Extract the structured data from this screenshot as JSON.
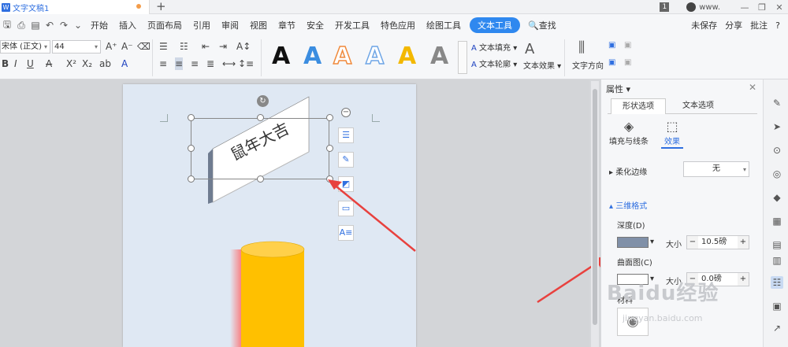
{
  "app": {
    "tab_title": "文字文稿1",
    "logo": "W",
    "page_badge": "1",
    "user": "www.",
    "window": {
      "minimize": "—",
      "restore": "❐",
      "close": "✕"
    }
  },
  "menubar": {
    "items": [
      "开始",
      "插入",
      "页面布局",
      "引用",
      "审阅",
      "视图",
      "章节",
      "安全",
      "开发工具",
      "特色应用",
      "绘图工具",
      "文本工具"
    ],
    "active": "文本工具",
    "search": "查找",
    "right": [
      "未保存",
      "分享",
      "批注"
    ],
    "help": "?"
  },
  "ribbon": {
    "font": "宋体 (正文)",
    "size": "44",
    "art_letter": "A",
    "art_colors": [
      "#111111",
      "#3b8de0",
      "#f08a3c",
      "#6fa6e6",
      "#f3b800",
      "#888888"
    ],
    "text_fill": "文本填充",
    "text_outline": "文本轮廓",
    "text_effect": "文本效果",
    "text_direction": "文字方向"
  },
  "document": {
    "shape_text": "鼠年大吉",
    "cylinder_color": "#ffc000",
    "banner_color": "#ffffff"
  },
  "panel": {
    "title": "属性",
    "tab_shape": "形状选项",
    "tab_text": "文本选项",
    "fill_line": "填充与线条",
    "effect": "效果",
    "soften": "柔化边缘",
    "soften_value": "无",
    "threed": "三维格式",
    "depth": "深度(D)",
    "size_label": "大小",
    "depth_value": "10.5磅",
    "contour": "曲面图(C)",
    "contour_value": "0.0磅",
    "material": "材料"
  },
  "watermark": {
    "logo": "Baidu经验",
    "url": "jingyan.baidu.com"
  }
}
